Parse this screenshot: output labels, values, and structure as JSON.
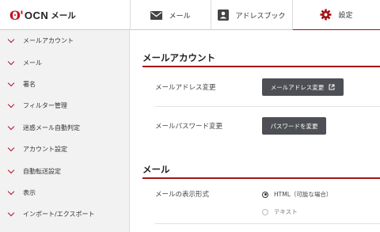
{
  "brand": {
    "mark": "ʘ'",
    "name": "OCN",
    "product": "メール"
  },
  "tabs": [
    {
      "id": "mail",
      "label": "メール",
      "icon": "envelope-icon"
    },
    {
      "id": "address",
      "label": "アドレスブック",
      "icon": "contact-card-icon"
    },
    {
      "id": "settings",
      "label": "設定",
      "icon": "gear-icon",
      "active": true
    }
  ],
  "sidebar": {
    "items": [
      {
        "label": "メールアカウント"
      },
      {
        "label": "メール"
      },
      {
        "label": "署名"
      },
      {
        "label": "フィルター管理"
      },
      {
        "label": "迷惑メール自動判定"
      },
      {
        "label": "アカウント設定"
      },
      {
        "label": "自動転送設定"
      },
      {
        "label": "表示"
      },
      {
        "label": "インポート/エクスポート"
      }
    ]
  },
  "main": {
    "account_section": {
      "title": "メールアカウント",
      "address_change": {
        "label": "メールアドレス変更",
        "button": "メールアドレス変更"
      },
      "password_change": {
        "label": "メールパスワード変更",
        "button": "パスワードを変更"
      }
    },
    "mail_section": {
      "title": "メール",
      "display_format": {
        "label": "メールの表示形式",
        "options": [
          {
            "label": "HTML（可能な場合）",
            "selected": true
          },
          {
            "label": "テキスト",
            "selected": false
          }
        ]
      }
    }
  },
  "colors": {
    "accent": "#a31318",
    "button": "#4d4f54",
    "sidebar_bg": "#f2f2f2"
  }
}
